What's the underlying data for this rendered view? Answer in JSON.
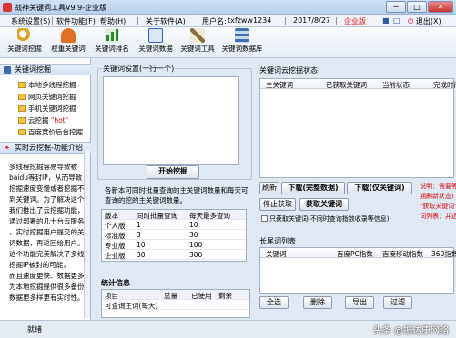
{
  "window": {
    "title": "战神关键词工具V9.9-企业版",
    "min": "─",
    "max": "□",
    "close": "✕"
  },
  "menu": {
    "items": [
      "系统设置(S)",
      "软件功能(F)",
      "帮助(H)",
      "关于软件(A)"
    ],
    "user_label": "用户名:",
    "username": "txfzww1234",
    "date": "2017/8/27",
    "edition": "企业版",
    "sys_icons": [
      "■",
      "□"
    ],
    "logout": "退出(X)"
  },
  "toolbar": {
    "items": [
      {
        "label": "关键词挖掘",
        "icon": "magnifier-icon",
        "color": "#e0a020"
      },
      {
        "label": "权重关键词",
        "icon": "medal-icon",
        "color": "#e07020"
      },
      {
        "label": "关键词排名",
        "icon": "ranking-chart-icon",
        "color": "#2a8a2a"
      },
      {
        "label": "关键词数据",
        "icon": "data-chart-icon",
        "color": "#3060c0"
      },
      {
        "label": "关键词工具",
        "icon": "tools-icon",
        "color": "#8a6a40"
      },
      {
        "label": "关键词数据库",
        "icon": "database-icon",
        "color": "#4070b0"
      }
    ]
  },
  "sidebar": {
    "section_title": "关键词挖掘",
    "tree": [
      "本地多线程挖掘",
      "网页关键词挖掘",
      "手机关键词挖掘",
      "云挖掘",
      "\"hot\"",
      "百度竞价后台挖掘"
    ],
    "intro_title": "实时云挖掘-功能介绍",
    "intro_lines": [
      "多线程挖掘容易导致被",
      "baidu等封IP，从而导致",
      "挖掘速度变慢或者挖掘不",
      "到关键词。为了解决这个问题",
      "我们推出了云挖掘功能，",
      "通过部署的几十台云服务器",
      "，实时挖掘用户提交的关键",
      "词数据，再返回给用户。",
      "这个功能完美解决了多线程",
      "挖掘IP被封的可能，",
      "而且速度更快、数据更多，",
      "为本地挖掘提供很多备份，",
      "数据更多样更有实时性。"
    ]
  },
  "center": {
    "kw_group_title": "关键词设置(一行一个)",
    "start_button": "开始挖掘",
    "quota_note": "各新本可同时批量查询的主关键词数量和每天可查询的挖的主关键词数量。",
    "quota_headers": [
      "版本",
      "同时批量查询",
      "每天最多查询"
    ],
    "quota_rows": [
      [
        "个人版",
        "1",
        "10"
      ],
      [
        "标准版",
        "3",
        "30"
      ],
      [
        "专业版",
        "10",
        "100"
      ],
      [
        "企业版",
        "30",
        "300"
      ]
    ],
    "stats_title": "统计信息",
    "stats_headers": [
      "项目",
      "总量",
      "已使用",
      "剩余"
    ],
    "stats_rows": [
      [
        "可查询主词(每天)",
        "",
        "",
        ""
      ]
    ]
  },
  "right": {
    "status_group_title": "关键词云挖掘状态",
    "status_headers": [
      "主关键词",
      "已获取关键词",
      "当前状态",
      "完成时间"
    ],
    "btn_refresh": "刷新",
    "btn_download_full": "下载(完整数据)",
    "btn_download_kw": "下载(仅关键词)",
    "btn_stop": "停止获取",
    "btn_fetch": "获取关键词",
    "side_note_lines": [
      "说明：需要等",
      "期刷新状态)",
      "\"获取关键词\"",
      "词列表：并选"
    ],
    "checkbox_label": "只获取关键词(不同时查询指数收录等信息)",
    "long_list_title": "长尾词列表",
    "long_headers": [
      "关键词",
      "百度PC指数",
      "百度移动指数",
      "360指数"
    ],
    "btn_select_all": "全选",
    "btn_delete": "删除",
    "btn_export": "导出",
    "btn_filter": "过滤"
  },
  "statusbar": {
    "text": "就绪",
    "watermark": "头条 @振达康网络"
  }
}
